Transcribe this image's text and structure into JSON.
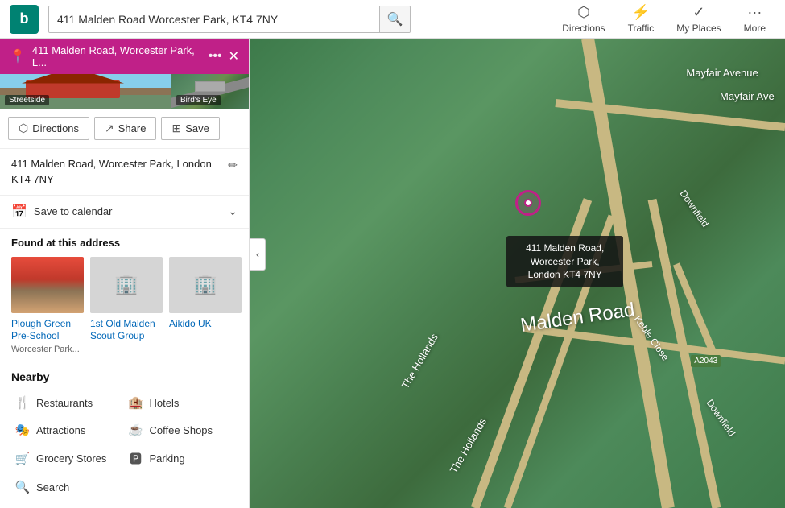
{
  "header": {
    "logo_text": "b",
    "search_value": "411 Malden Road Worcester Park, KT4 7NY",
    "nav_items": [
      {
        "id": "directions",
        "label": "Directions",
        "icon": "⬡"
      },
      {
        "id": "traffic",
        "label": "Traffic",
        "icon": "⚡"
      },
      {
        "id": "my_places",
        "label": "My Places",
        "icon": "✓"
      },
      {
        "id": "more",
        "label": "More",
        "icon": "···"
      }
    ]
  },
  "sidebar": {
    "header": {
      "pin_icon": "📍",
      "address": "411 Malden Road, Worcester Park, L...",
      "more_icon": "•••",
      "close_icon": "✕"
    },
    "photos": {
      "streetside_label": "Streetside",
      "birdeye_label": "Bird's Eye"
    },
    "buttons": [
      {
        "id": "directions",
        "icon": "⬡",
        "label": "Directions"
      },
      {
        "id": "share",
        "icon": "↗",
        "label": "Share"
      },
      {
        "id": "save",
        "icon": "⊞",
        "label": "Save"
      }
    ],
    "address_full": "411 Malden Road, Worcester Park, London KT4 7NY",
    "calendar": {
      "icon": "📅",
      "label": "Save to calendar",
      "chevron": "⌄"
    },
    "found_section": {
      "title": "Found at this address",
      "items": [
        {
          "name": "Plough Green Pre-School",
          "sub": "Worcester Park...",
          "type": "colored"
        },
        {
          "name": "1st Old Malden Scout Group",
          "sub": "",
          "type": "gray"
        },
        {
          "name": "Aikido UK",
          "sub": "",
          "type": "gray"
        }
      ]
    },
    "nearby": {
      "title": "Nearby",
      "items": [
        {
          "icon": "🍴",
          "label": "Restaurants",
          "col": 1
        },
        {
          "icon": "🏨",
          "label": "Hotels",
          "col": 2
        },
        {
          "icon": "🎭",
          "label": "Attractions",
          "col": 1
        },
        {
          "icon": "☕",
          "label": "Coffee Shops",
          "col": 2
        },
        {
          "icon": "🛒",
          "label": "Grocery Stores",
          "col": 1
        },
        {
          "icon": "🅿",
          "label": "Parking",
          "col": 2
        },
        {
          "icon": "🔍",
          "label": "Search",
          "col": 1
        }
      ]
    }
  },
  "map": {
    "pin_callout": "411 Malden Road, Worcester Park, London KT4 7NY",
    "labels": {
      "malden_road": "Malden Road",
      "mayfair_avenue": "Mayfair Avenue",
      "mayfair_ave2": "Mayfair Ave",
      "the_hollands1": "The Hollands",
      "the_hollands2": "The Hollands",
      "keble_close": "Keble Close",
      "downfield1": "Downfield",
      "downfield2": "Downfield",
      "a2043": "A2043"
    }
  },
  "colors": {
    "brand_pink": "#c02088",
    "link_blue": "#0067b8",
    "map_road": "#c8b882"
  }
}
